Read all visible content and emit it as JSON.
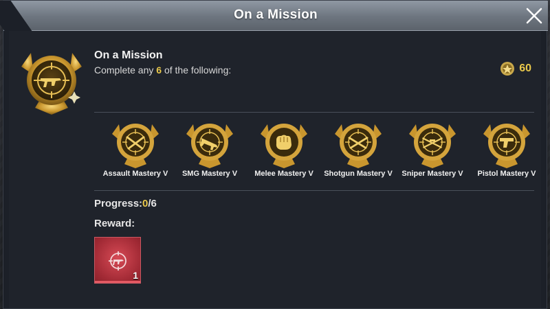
{
  "dialog": {
    "title": "On a Mission"
  },
  "mission": {
    "name": "On a Mission",
    "desc_prefix": "Complete any ",
    "desc_count": "6",
    "desc_suffix": " of the following:",
    "badge_icon": "smg-medal-icon",
    "points_icon": "achievement-points-icon",
    "points": "60"
  },
  "requirements": [
    {
      "label": "Assault Mastery V",
      "icon": "assault-rifle-medal-icon"
    },
    {
      "label": "SMG Mastery V",
      "icon": "smg-medal-icon"
    },
    {
      "label": "Melee Mastery V",
      "icon": "melee-fist-medal-icon"
    },
    {
      "label": "Shotgun Mastery V",
      "icon": "shotgun-medal-icon"
    },
    {
      "label": "Sniper Mastery V",
      "icon": "sniper-medal-icon"
    },
    {
      "label": "Pistol Mastery V",
      "icon": "pistol-medal-icon"
    }
  ],
  "progress": {
    "label": "Progress:",
    "current": "0",
    "total": "/6"
  },
  "reward": {
    "label": "Reward:",
    "icon": "gun-crosshair-reward-icon",
    "quantity": "1"
  },
  "colors": {
    "accent_gold": "#e9c84b",
    "reward_bg": "#b8313d",
    "title_bar": "#7a828c"
  }
}
